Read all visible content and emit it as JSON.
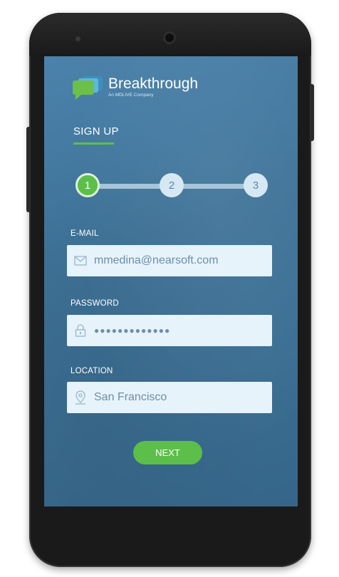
{
  "app": {
    "brand_name": "Breakthrough",
    "brand_tagline": "An MDLIVE Company"
  },
  "page": {
    "title": "SIGN UP"
  },
  "stepper": {
    "steps": [
      {
        "label": "1",
        "state": "active"
      },
      {
        "label": "2",
        "state": "inactive"
      },
      {
        "label": "3",
        "state": "inactive"
      }
    ]
  },
  "form": {
    "email": {
      "label": "E-MAIL",
      "value": "mmedina@nearsoft.com",
      "icon": "envelope-icon"
    },
    "password": {
      "label": "PASSWORD",
      "value": "●●●●●●●●●●●●●",
      "icon": "lock-icon"
    },
    "location": {
      "label": "LOCATION",
      "value": "San Francisco",
      "icon": "map-pin-icon"
    },
    "next_label": "NEXT"
  },
  "colors": {
    "screen_bg": "#3f7399",
    "accent_green": "#5cbf4a",
    "field_bg": "#e6f3fb",
    "field_text": "#6f8ea6"
  }
}
